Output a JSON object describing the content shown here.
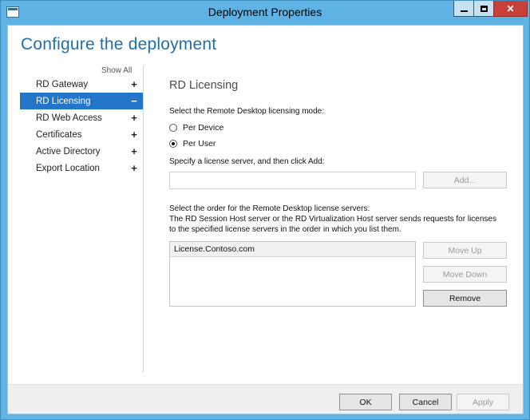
{
  "window": {
    "title": "Deployment Properties",
    "close_glyph": "✕"
  },
  "page": {
    "title": "Configure the deployment"
  },
  "nav": {
    "show_all": "Show All",
    "items": [
      {
        "label": "RD Gateway",
        "expander": "+"
      },
      {
        "label": "RD Licensing",
        "expander": "−"
      },
      {
        "label": "RD Web Access",
        "expander": "+"
      },
      {
        "label": "Certificates",
        "expander": "+"
      },
      {
        "label": "Active Directory",
        "expander": "+"
      },
      {
        "label": "Export Location",
        "expander": "+"
      }
    ],
    "selected": "RD Licensing"
  },
  "licensing": {
    "section_title": "RD Licensing",
    "mode_prompt": "Select the Remote Desktop licensing mode:",
    "modes": [
      {
        "label": "Per Device",
        "checked": false
      },
      {
        "label": "Per User",
        "checked": true
      }
    ],
    "server_prompt": "Specify a license server, and then click Add:",
    "server_input_value": "",
    "add_label": "Add...",
    "order_prompt_1": "Select the order for the Remote Desktop license servers:",
    "order_prompt_2": "The RD Session Host server or the RD Virtualization Host server sends requests for licenses",
    "order_prompt_3": "to the specified license servers in the order in which you list them.",
    "servers": [
      "License.Contoso.com"
    ],
    "move_up_label": "Move Up",
    "move_down_label": "Move Down",
    "remove_label": "Remove"
  },
  "footer": {
    "ok_label": "OK",
    "cancel_label": "Cancel",
    "apply_label": "Apply"
  }
}
